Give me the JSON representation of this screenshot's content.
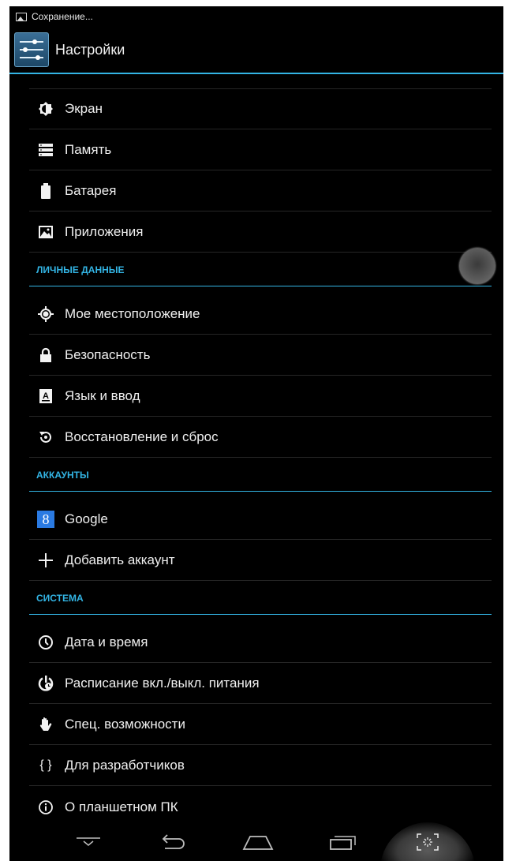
{
  "status_bar": {
    "icon": "image-icon",
    "text": "Сохранение..."
  },
  "action_bar": {
    "icon": "settings-sliders-icon",
    "title": "Настройки"
  },
  "accent_color": "#33b5e5",
  "items": {
    "display": {
      "icon": "brightness-icon",
      "label": "Экран"
    },
    "storage": {
      "icon": "storage-icon",
      "label": "Память"
    },
    "battery": {
      "icon": "battery-icon",
      "label": "Батарея"
    },
    "apps": {
      "icon": "apps-icon",
      "label": "Приложения"
    },
    "location": {
      "icon": "location-icon",
      "label": "Мое местоположение"
    },
    "security": {
      "icon": "lock-icon",
      "label": "Безопасность"
    },
    "language": {
      "icon": "keyboard-icon",
      "label": "Язык и ввод"
    },
    "backup": {
      "icon": "restore-icon",
      "label": "Восстановление и сброс"
    },
    "google": {
      "icon": "google-icon",
      "icon_letter": "8",
      "label": "Google"
    },
    "add_account": {
      "icon": "plus-icon",
      "label": "Добавить аккаунт"
    },
    "date_time": {
      "icon": "clock-icon",
      "label": "Дата и время"
    },
    "power_schedule": {
      "icon": "power-schedule-icon",
      "label": "Расписание вкл./выкл. питания"
    },
    "accessibility": {
      "icon": "hand-icon",
      "label": "Спец. возможности"
    },
    "developer": {
      "icon": "braces-icon",
      "icon_glyph": "{ }",
      "label": "Для разработчиков"
    },
    "about": {
      "icon": "info-icon",
      "label": "О планшетном ПК"
    }
  },
  "sections": {
    "personal": "ЛИЧНЫЕ ДАННЫЕ",
    "accounts": "АККАУНТЫ",
    "system": "СИСТЕМА"
  },
  "nav_bar": {
    "buttons": [
      "hide-keyboard-icon",
      "back-icon",
      "home-icon",
      "recents-icon",
      "screenshot-icon"
    ]
  }
}
